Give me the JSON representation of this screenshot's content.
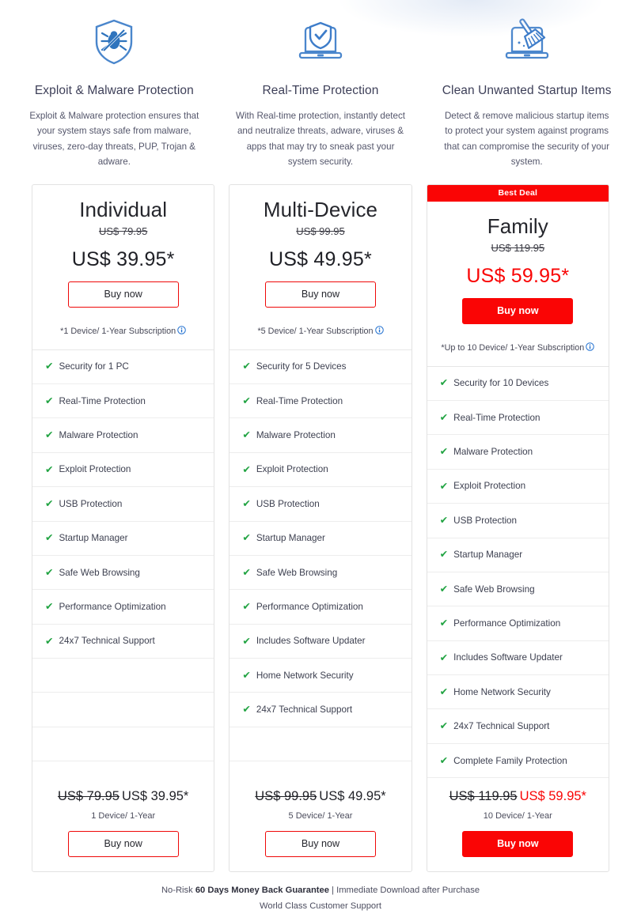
{
  "features": [
    {
      "icon": "shield-bug-icon",
      "title": "Exploit & Malware Protection",
      "desc": "Exploit & Malware protection ensures that your system stays safe from malware, viruses, zero-day threats, PUP, Trojan & adware."
    },
    {
      "icon": "laptop-shield-check-icon",
      "title": "Real-Time Protection",
      "desc": "With Real-time protection, instantly detect and neutralize threats, adware, viruses & apps that may try to sneak past your system security."
    },
    {
      "icon": "laptop-broom-icon",
      "title": "Clean Unwanted Startup Items",
      "desc": "Detect & remove malicious startup items to protect your system against programs that can compromise the security of your system."
    }
  ],
  "plans": [
    {
      "badge": "",
      "name": "Individual",
      "old_price": "US$ 79.95",
      "new_price": "US$ 39.95*",
      "buy_label": "Buy now",
      "sub_note": "*1 Device/ 1-Year Subscription",
      "highlight": false,
      "features": [
        "Security for 1 PC",
        "Real-Time Protection",
        "Malware Protection",
        "Exploit Protection",
        "USB Protection",
        "Startup Manager",
        "Safe Web Browsing",
        "Performance Optimization",
        "24x7 Technical Support"
      ],
      "foot_old_price": "US$ 79.95",
      "foot_new_price": "US$ 39.95*",
      "foot_term": "1 Device/ 1-Year",
      "foot_buy_label": "Buy now"
    },
    {
      "badge": "",
      "name": "Multi-Device",
      "old_price": "US$ 99.95",
      "new_price": "US$ 49.95*",
      "buy_label": "Buy now",
      "sub_note": "*5 Device/ 1-Year Subscription",
      "highlight": false,
      "features": [
        "Security for 5 Devices",
        "Real-Time Protection",
        "Malware Protection",
        "Exploit Protection",
        "USB Protection",
        "Startup Manager",
        "Safe Web Browsing",
        "Performance Optimization",
        "Includes Software Updater",
        "Home Network Security",
        "24x7 Technical Support"
      ],
      "foot_old_price": "US$ 99.95",
      "foot_new_price": "US$ 49.95*",
      "foot_term": "5 Device/ 1-Year",
      "foot_buy_label": "Buy now"
    },
    {
      "badge": "Best Deal",
      "name": "Family",
      "old_price": "US$ 119.95",
      "new_price": "US$ 59.95*",
      "buy_label": "Buy now",
      "sub_note": "*Up to 10 Device/ 1-Year Subscription",
      "highlight": true,
      "features": [
        "Security for 10 Devices",
        "Real-Time Protection",
        "Malware Protection",
        "Exploit Protection",
        "USB Protection",
        "Startup Manager",
        "Safe Web Browsing",
        "Performance Optimization",
        "Includes Software Updater",
        "Home Network Security",
        "24x7 Technical Support",
        "Complete Family Protection"
      ],
      "foot_old_price": "US$ 119.95",
      "foot_new_price": "US$ 59.95*",
      "foot_term": "10 Device/ 1-Year",
      "foot_buy_label": "Buy now"
    }
  ],
  "footer": {
    "line1_prefix": "No-Risk ",
    "line1_bold": "60 Days Money Back Guarantee",
    "line1_suffix": " | Immediate Download after Purchase",
    "line2": "World Class Customer Support"
  },
  "colors": {
    "accent_red": "#fa0505",
    "tick_green": "#21a342",
    "icon_blue": "#3d7cc9"
  },
  "tick_glyph": "✔"
}
